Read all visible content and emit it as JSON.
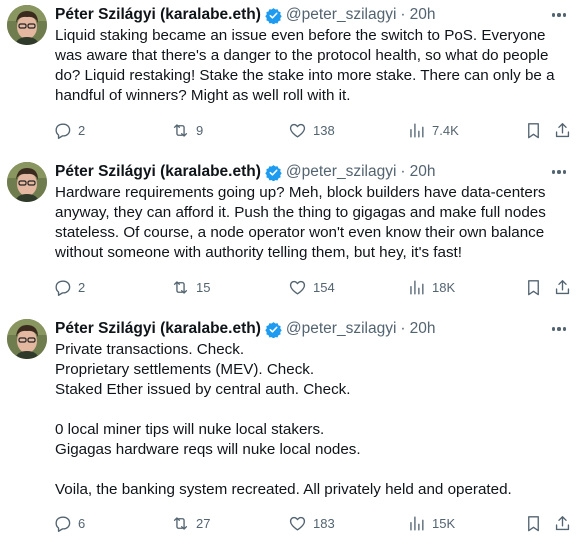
{
  "tweets": [
    {
      "author_name": "Péter Szilágyi (karalabe.eth)",
      "handle": "@peter_szilagyi",
      "separator": "·",
      "time": "20h",
      "lines": [
        "Liquid staking became an issue even before the switch to PoS. Everyone",
        "was aware that there's a danger to the protocol health, so what do people",
        "do? Liquid restaking! Stake the stake into more stake. There can only be a",
        "handful of winners? Might as well roll with it."
      ],
      "replies": "2",
      "reposts": "9",
      "likes": "138",
      "views": "7.4K"
    },
    {
      "author_name": "Péter Szilágyi (karalabe.eth)",
      "handle": "@peter_szilagyi",
      "separator": "·",
      "time": "20h",
      "lines": [
        "Hardware requirements going up? Meh, block builders have data-centers",
        "anyway, they can afford it. Push the thing to gigagas and make full nodes",
        "stateless. Of course, a node operator won't even know their own balance",
        "without someone with authority telling them, but hey, it's fast!"
      ],
      "replies": "2",
      "reposts": "15",
      "likes": "154",
      "views": "18K"
    },
    {
      "author_name": "Péter Szilágyi (karalabe.eth)",
      "handle": "@peter_szilagyi",
      "separator": "·",
      "time": "20h",
      "lines": [
        "Private transactions. Check.",
        "Proprietary settlements (MEV). Check.",
        "Staked Ether issued by central auth. Check.",
        "",
        "0 local miner tips will nuke local stakers.",
        "Gigagas hardware reqs will nuke local nodes.",
        "",
        "Voila, the banking system recreated. All privately held and operated."
      ],
      "replies": "6",
      "reposts": "27",
      "likes": "183",
      "views": "15K"
    }
  ],
  "icons": {
    "verified": "verified-badge-icon",
    "more": "more-icon",
    "reply": "reply-icon",
    "repost": "repost-icon",
    "like": "heart-icon",
    "views": "views-icon",
    "bookmark": "bookmark-icon",
    "share": "share-icon"
  },
  "colors": {
    "text": "#0f1419",
    "secondary": "#536471",
    "verified": "#1d9bf0",
    "background": "#ffffff"
  }
}
